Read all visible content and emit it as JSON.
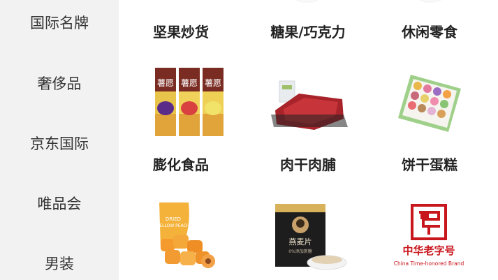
{
  "sidebar": {
    "items": [
      {
        "label": "国际名牌"
      },
      {
        "label": "奢侈品"
      },
      {
        "label": "京东国际"
      },
      {
        "label": "唯品会"
      },
      {
        "label": "男装"
      }
    ]
  },
  "categories": {
    "row1": [
      "坚果炒货",
      "糖果/巧克力",
      "休闲零食"
    ],
    "row2": [
      "膨化食品",
      "肉干肉脯",
      "饼干蛋糕"
    ]
  },
  "product_art": {
    "chips_brand": "薯愿",
    "oat_brand": "燕麦片",
    "oat_sub": "0%添加蔗糖",
    "peach_label_line1": "DRIED",
    "peach_label_line2": "YELLOW PEACH",
    "laozihao_cn": "中华老字号",
    "laozihao_en": "China Time-honored Brand"
  },
  "colors": {
    "sidebar_bg": "#f2f2f2",
    "brand_red": "#c8161d"
  }
}
